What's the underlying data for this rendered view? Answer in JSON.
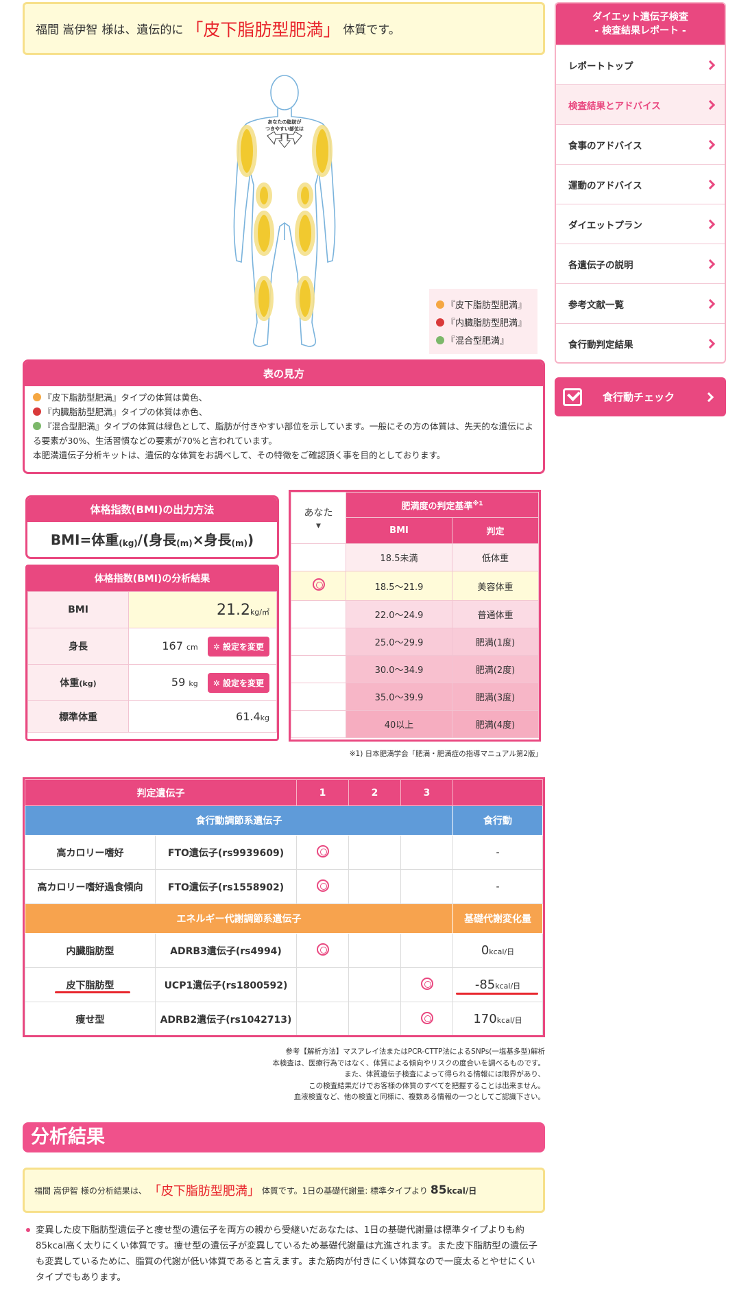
{
  "banner": {
    "name": "福間 嵩伊智",
    "honorific": "様は、遺伝的に",
    "type": "「皮下脂肪型肥満」",
    "suffix": "体質です。"
  },
  "figure": {
    "callout_line1": "あなたの脂肪が",
    "callout_line2": "つきやすい部位は"
  },
  "legend": {
    "items": [
      {
        "label": "『皮下脂肪型肥満』",
        "color": "#f5a742"
      },
      {
        "label": "『内臓脂肪型肥満』",
        "color": "#d93a3a"
      },
      {
        "label": "『混合型肥満』",
        "color": "#7cb86a"
      }
    ]
  },
  "howto": {
    "title": "表の見方",
    "line1": "『皮下脂肪型肥満』タイプの体質は黄色、",
    "line2": "『内臓脂肪型肥満』タイプの体質は赤色、",
    "line3": "『混合型肥満』タイプの体質は緑色として、脂肪が付きやすい部位を示しています。一般にその方の体質は、先天的な遺伝による要素が30%、生活習慣などの要素が70%と言われています。",
    "line4": "本肥満遺伝子分析キットは、遺伝的な体質をお調べして、その特徴をご確認頂く事を目的としております。"
  },
  "bmi_formula": {
    "title": "体格指数(BMI)の出力方法",
    "bmi": "BMI",
    "eq": "=体重",
    "kg": "(kg)",
    "div": "/(身長",
    "m1": "(m)",
    "times": "×身長",
    "m2": "(m)",
    "close": ")"
  },
  "bmi_result": {
    "title": "体格指数(BMI)の分析結果",
    "rows": [
      {
        "label": "BMI",
        "value": "21.2",
        "unit": "kg/㎡"
      },
      {
        "label": "身長",
        "value": "167",
        "unit": "cm",
        "button": "設定を変更"
      },
      {
        "label": "体重",
        "label_unit": "(kg)",
        "value": "59",
        "unit": "kg",
        "button": "設定を変更"
      },
      {
        "label": "標準体重",
        "value": "61.4",
        "unit": "kg"
      }
    ]
  },
  "criteria": {
    "you": "あなた",
    "title": "肥満度の判定基準",
    "note_mark": "※1",
    "col_bmi": "BMI",
    "col_judge": "判定",
    "rows": [
      {
        "bmi": "18.5未満",
        "judge": "低体重",
        "you": ""
      },
      {
        "bmi": "18.5〜21.9",
        "judge": "美容体重",
        "you": "◎"
      },
      {
        "bmi": "22.0〜24.9",
        "judge": "普通体重",
        "you": ""
      },
      {
        "bmi": "25.0〜29.9",
        "judge": "肥満(1度)",
        "you": ""
      },
      {
        "bmi": "30.0〜34.9",
        "judge": "肥満(2度)",
        "you": ""
      },
      {
        "bmi": "35.0〜39.9",
        "judge": "肥満(3度)",
        "you": ""
      },
      {
        "bmi": "40以上",
        "judge": "肥満(4度)",
        "you": ""
      }
    ],
    "footnote": "※1) 日本肥満学会「肥満・肥満症の指導マニュアル第2版」"
  },
  "gene_table": {
    "col_gene": "判定遺伝子",
    "col1": "1",
    "col2": "2",
    "col3": "3",
    "section1": "食行動調節系遺伝子",
    "section1_right": "食行動",
    "section2": "エネルギー代謝調節系遺伝子",
    "section2_right": "基礎代謝変化量",
    "rows1": [
      {
        "type": "高カロリー嗜好",
        "gene": "FTO遺伝子(rs9939609)",
        "mark": 1,
        "value": "-"
      },
      {
        "type": "高カロリー嗜好過食傾向",
        "gene": "FTO遺伝子(rs1558902)",
        "mark": 1,
        "value": "-"
      }
    ],
    "rows2": [
      {
        "type": "内臓脂肪型",
        "gene": "ADRB3遺伝子(rs4994)",
        "mark": 1,
        "value": "0",
        "unit": "kcal/日"
      },
      {
        "type": "皮下脂肪型",
        "gene": "UCP1遺伝子(rs1800592)",
        "mark": 3,
        "value": "-85",
        "unit": "kcal/日"
      },
      {
        "type": "痩せ型",
        "gene": "ADRB2遺伝子(rs1042713)",
        "mark": 3,
        "value": "170",
        "unit": "kcal/日"
      }
    ]
  },
  "method_notes": {
    "line1": "参考【解析方法】マスアレイ法またはPCR-CTTP法によるSNPs(一塩基多型)解析",
    "line2": "本検査は、医療行為ではなく、体質による傾向やリスクの度合いを調べるものです。",
    "line3": "また、体質遺伝子検査によって得られる情報には限界があり、",
    "line4": "この検査結果だけでお客様の体質のすべてを把握することは出来ません。",
    "line5": "血液検査など、他の検査と同様に、複数ある情報の一つとしてご認識下さい。"
  },
  "analysis": {
    "heading": "分析結果",
    "name": "福間 嵩伊智",
    "pre": "様の分析結果は、",
    "type": "「皮下脂肪型肥満」",
    "mid": "体質です。1日の基礎代謝量: 標準タイプより",
    "value": "85",
    "unit": "kcal/日",
    "text": "変異した皮下脂肪型遺伝子と痩せ型の遺伝子を両方の親から受継いだあなたは、1日の基礎代謝量は標準タイプよりも約85kcal高く太りにくい体質です。痩せ型の遺伝子が変異しているため基礎代謝量は亢進されます。また皮下脂肪型の遺伝子も変異しているために、脂質の代謝が低い体質であると言えます。また筋肉が付きにくい体質なので一度太るとやせにくいタイプでもあります。"
  },
  "sidebar": {
    "title_line1": "ダイエット遺伝子検査",
    "title_line2": "- 検査結果レポート -",
    "items": [
      {
        "label": "レポートトップ"
      },
      {
        "label": "検査結果とアドバイス",
        "active": true
      },
      {
        "label": "食事のアドバイス"
      },
      {
        "label": "運動のアドバイス"
      },
      {
        "label": "ダイエットプラン"
      },
      {
        "label": "各遺伝子の説明"
      },
      {
        "label": "参考文献一覧"
      },
      {
        "label": "食行動判定結果"
      }
    ],
    "check_button": "食行動チェック"
  }
}
